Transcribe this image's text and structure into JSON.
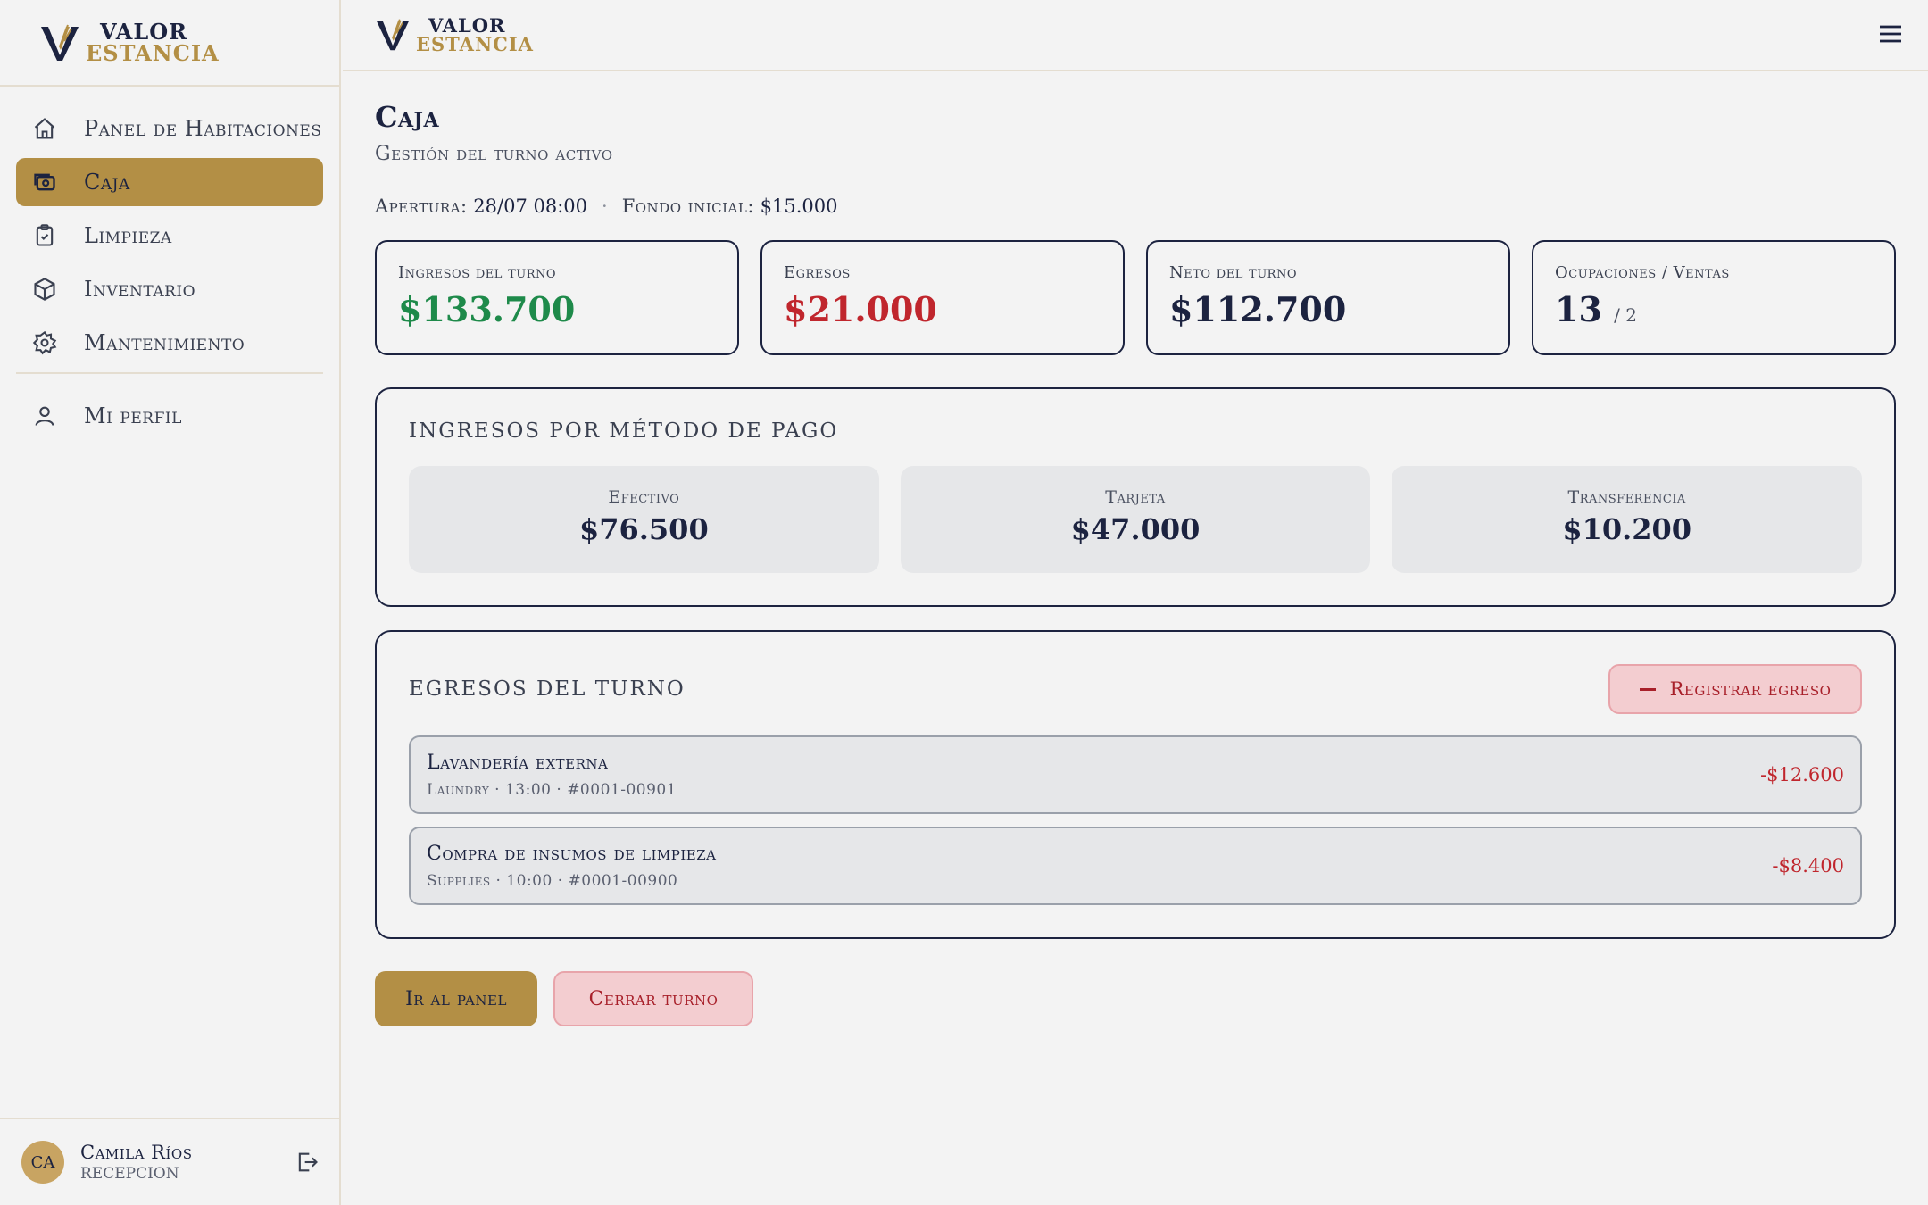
{
  "brand": {
    "line1": "VALOR",
    "line2": "ESTANCIA"
  },
  "sidebar": {
    "items": [
      {
        "label": "Panel de Habitaciones",
        "icon": "home-icon"
      },
      {
        "label": "Caja",
        "icon": "cash-register-icon",
        "active": true
      },
      {
        "label": "Limpieza",
        "icon": "clipboard-check-icon"
      },
      {
        "label": "Inventario",
        "icon": "box-icon"
      },
      {
        "label": "Mantenimiento",
        "icon": "gear-icon"
      }
    ],
    "profile_item": {
      "label": "Mi perfil",
      "icon": "user-icon"
    },
    "user": {
      "initials": "CA",
      "name": "Camila Ríos",
      "role": "RECEPCION"
    }
  },
  "page": {
    "title": "Caja",
    "subtitle": "Gestión del turno activo",
    "opening_label": "Apertura:",
    "opening_value": "28/07 08:00",
    "separator": "·",
    "fund_label": "Fondo inicial:",
    "fund_value": "$15.000"
  },
  "stats": {
    "income": {
      "label": "Ingresos del turno",
      "value": "$133.700"
    },
    "expenses": {
      "label": "Egresos",
      "value": "$21.000"
    },
    "net": {
      "label": "Neto del turno",
      "value": "$112.700"
    },
    "occupancy": {
      "label": "Ocupaciones / Ventas",
      "value": "13",
      "secondary": "/ 2"
    }
  },
  "payment_methods": {
    "title": "Ingresos por método de pago",
    "items": [
      {
        "label": "Efectivo",
        "value": "$76.500"
      },
      {
        "label": "Tarjeta",
        "value": "$47.000"
      },
      {
        "label": "Transferencia",
        "value": "$10.200"
      }
    ]
  },
  "expenses_section": {
    "title": "Egresos del turno",
    "register_button": "Registrar egreso",
    "items": [
      {
        "title": "Lavandería externa",
        "detail": "Laundry · 13:00 · #0001-00901",
        "amount": "-$12.600"
      },
      {
        "title": "Compra de insumos de limpieza",
        "detail": "Supplies · 10:00 · #0001-00900",
        "amount": "-$8.400"
      }
    ]
  },
  "actions": {
    "panel_button": "Ir al panel",
    "close_button": "Cerrar turno"
  },
  "colors": {
    "accent": "#b38f45",
    "navy": "#1c2340",
    "positive": "#1e8a4a",
    "negative": "#c0262d",
    "danger_bg": "#f3cdd0"
  }
}
